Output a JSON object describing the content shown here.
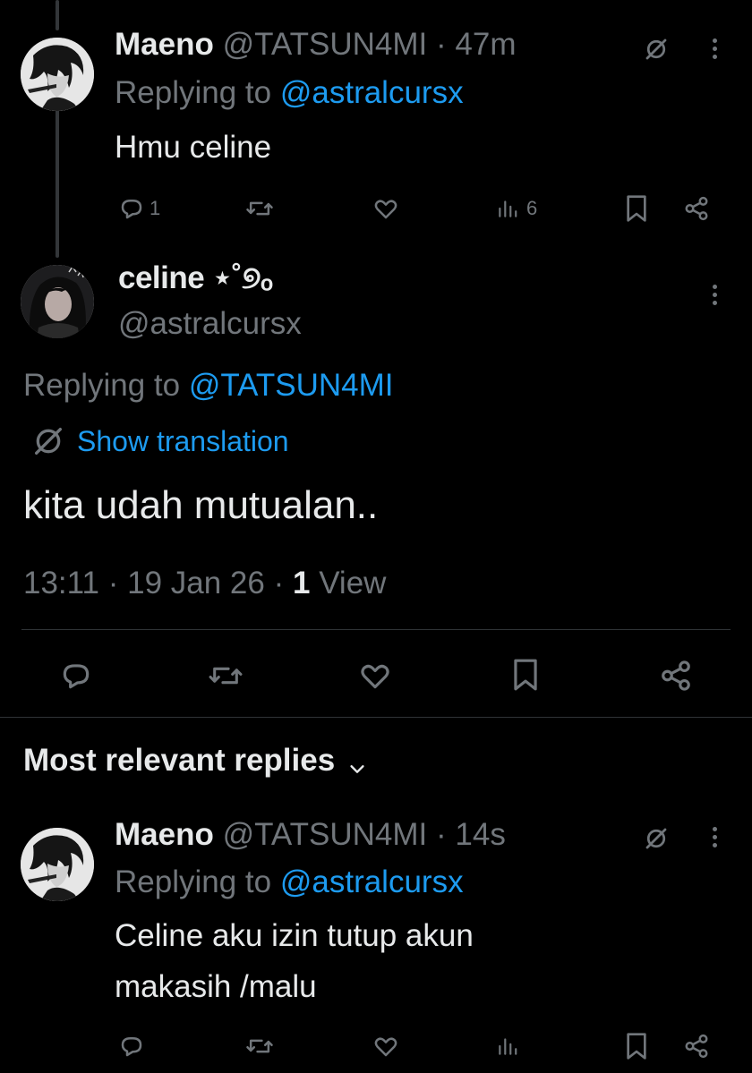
{
  "colors": {
    "background": "#000000",
    "text": "#e7e9ea",
    "muted": "#71767b",
    "link": "#1d9bf0",
    "divider": "#2f3336"
  },
  "tweet1": {
    "name": "Maeno",
    "handle": "@TATSUN4MI",
    "time": "· 47m",
    "replying_prefix": "Replying to",
    "replying_handle": "@astralcursx",
    "text": "Hmu celine",
    "reply_count": "1",
    "views": "6",
    "icons": [
      "translate-icon",
      "more-icon",
      "reply-icon",
      "retweet-icon",
      "like-icon",
      "views-icon",
      "bookmark-icon",
      "share-icon"
    ]
  },
  "main": {
    "name": "celine ⋆˚୭ₒ",
    "handle": "@astralcursx",
    "replying_prefix": "Replying to",
    "replying_handle": "@TATSUN4MI",
    "show_translation": "Show translation",
    "text": "kita udah mutualan..",
    "time": "13:11",
    "date": "19 Jan 26",
    "view_count": "1",
    "view_label": "View"
  },
  "replies_header": {
    "label": "Most relevant replies"
  },
  "tweet2": {
    "name": "Maeno",
    "handle": "@TATSUN4MI",
    "time": "· 14s",
    "replying_prefix": "Replying to",
    "replying_handle": "@astralcursx",
    "text_line1": "Celine aku izin tutup akun",
    "text_line2": "makasih /malu"
  }
}
